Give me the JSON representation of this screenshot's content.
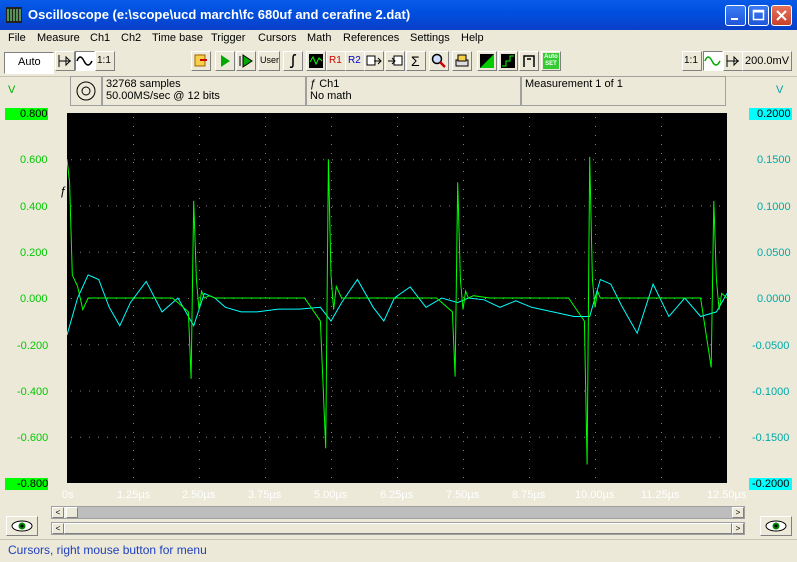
{
  "window": {
    "title": "Oscilloscope (e:\\scope\\ucd march\\fc 680uf and cerafine 2.dat)"
  },
  "menu": [
    "File",
    "Measure",
    "Ch1",
    "Ch2",
    "Time base",
    "Trigger",
    "Cursors",
    "Math",
    "References",
    "Settings",
    "Help"
  ],
  "toolbar": {
    "trigger_mode": "Auto",
    "ch1_ratio": "1:1",
    "ch2_ratio": "1:1",
    "user_label": "User",
    "r1_label": "R1",
    "r2_label": "R2",
    "autoset_label": "Auto SET",
    "volts_div": "200.0mV"
  },
  "info": {
    "samples": "32768 samples",
    "rate": "50.00MS/sec @ 12 bits",
    "channel": "Ch1",
    "math": "No math",
    "measurement": "Measurement 1 of 1"
  },
  "axes": {
    "left_unit": "V",
    "right_unit": "V",
    "left_ticks": [
      "0.800",
      "0.600",
      "0.400",
      "0.200",
      "0.000",
      "-0.200",
      "-0.400",
      "-0.600",
      "-0.800"
    ],
    "right_ticks": [
      "0.2000",
      "0.1500",
      "0.1000",
      "0.0500",
      "0.0000",
      "-0.0500",
      "-0.1000",
      "-0.1500",
      "-0.2000"
    ],
    "x_ticks": [
      "0s",
      "1.25µs",
      "2.50µs",
      "3.75µs",
      "5.00µs",
      "6.25µs",
      "7.50µs",
      "8.75µs",
      "10.00µs",
      "11.25µs",
      "12.50µs"
    ],
    "colors": {
      "ch1": "#00ff00",
      "ch2": "#00ffff",
      "background": "#000000"
    }
  },
  "status": {
    "text": "Cursors, right mouse button for menu"
  },
  "chart_data": {
    "type": "line",
    "x_unit": "µs",
    "xlim": [
      0,
      12.5
    ],
    "series": [
      {
        "axis": "left",
        "ylim": [
          -0.8,
          0.8
        ],
        "x": [
          0,
          0.05,
          0.1,
          0.2,
          0.3,
          0.4,
          0.5,
          1.0,
          1.5,
          2.0,
          2.3,
          2.35,
          2.4,
          2.45,
          2.5,
          2.55,
          2.6,
          2.7,
          2.8,
          3.0,
          3.5,
          4.0,
          4.5,
          4.8,
          4.9,
          4.95,
          5.0,
          5.05,
          5.1,
          5.2,
          5.5,
          6.0,
          6.5,
          7.0,
          7.3,
          7.35,
          7.4,
          7.45,
          7.5,
          7.55,
          7.6,
          7.7,
          8.0,
          8.5,
          9.0,
          9.5,
          9.8,
          9.85,
          9.9,
          9.95,
          10.0,
          10.05,
          10.1,
          10.2,
          10.5,
          11.0,
          11.5,
          12.0,
          12.2,
          12.25,
          12.3,
          12.35,
          12.4,
          12.5
        ],
        "y": [
          0.6,
          0.5,
          0.1,
          0.05,
          -0.05,
          0.0,
          0.0,
          0.0,
          0.0,
          0.0,
          -0.06,
          -0.35,
          0.42,
          0.08,
          -0.05,
          0.03,
          0.0,
          0.01,
          0.0,
          0.0,
          0.0,
          0.0,
          0.0,
          -0.1,
          -0.65,
          0.6,
          0.1,
          -0.05,
          0.05,
          0.0,
          0.0,
          0.0,
          0.0,
          0.0,
          -0.06,
          -0.34,
          0.5,
          0.08,
          -0.05,
          0.03,
          0.0,
          0.01,
          0.0,
          0.0,
          0.0,
          0.0,
          -0.1,
          -0.72,
          0.61,
          0.08,
          -0.04,
          0.03,
          0.0,
          0.0,
          0.0,
          0.0,
          0.0,
          0.0,
          -0.3,
          0.42,
          0.08,
          -0.05,
          0.02,
          0.0
        ]
      },
      {
        "axis": "right",
        "ylim": [
          -0.2,
          0.2
        ],
        "x": [
          0,
          0.2,
          0.4,
          0.6,
          0.8,
          1.0,
          1.2,
          1.5,
          1.8,
          2.1,
          2.4,
          2.6,
          2.8,
          3.0,
          3.3,
          3.6,
          4.0,
          4.4,
          4.8,
          5.0,
          5.2,
          5.5,
          5.8,
          6.0,
          6.2,
          6.5,
          6.8,
          7.1,
          7.4,
          7.6,
          7.9,
          8.2,
          8.5,
          8.8,
          9.2,
          9.6,
          9.9,
          10.1,
          10.3,
          10.5,
          10.8,
          11.1,
          11.4,
          11.7,
          12.0,
          12.3,
          12.5
        ],
        "y": [
          -0.04,
          0.0,
          0.025,
          0.02,
          -0.01,
          -0.03,
          -0.005,
          0.018,
          -0.015,
          0.0,
          -0.03,
          0.005,
          0.0,
          -0.01,
          -0.015,
          -0.015,
          -0.012,
          -0.012,
          -0.01,
          -0.025,
          -0.005,
          0.02,
          -0.01,
          -0.025,
          0.0,
          0.012,
          -0.01,
          0.0,
          -0.005,
          0.0,
          -0.002,
          -0.01,
          -0.003,
          -0.01,
          -0.015,
          -0.02,
          -0.02,
          0.02,
          0.015,
          -0.008,
          -0.038,
          0.015,
          -0.02,
          0.0,
          -0.02,
          -0.015,
          0.005
        ]
      }
    ]
  }
}
